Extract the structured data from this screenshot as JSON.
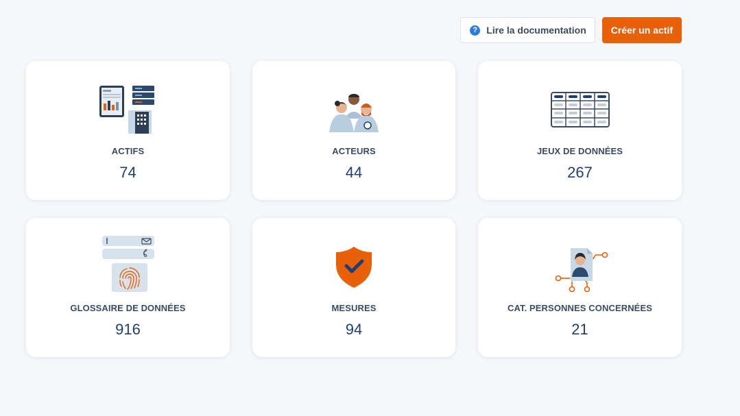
{
  "header": {
    "doc_button_label": "Lire la documentation",
    "create_button_label": "Créer un actif"
  },
  "cards": [
    {
      "label": "ACTIFS",
      "count": "74",
      "icon": "assets-icon"
    },
    {
      "label": "ACTEURS",
      "count": "44",
      "icon": "people-group-icon"
    },
    {
      "label": "JEUX DE DONNÉES",
      "count": "267",
      "icon": "data-table-icon"
    },
    {
      "label": "GLOSSAIRE DE DONNÉES",
      "count": "916",
      "icon": "fingerprint-form-icon"
    },
    {
      "label": "MESURES",
      "count": "94",
      "icon": "shield-check-icon"
    },
    {
      "label": "CAT. PERSONNES CONCERNÉES",
      "count": "21",
      "icon": "person-network-icon"
    }
  ],
  "colors": {
    "accent": "#e8600a",
    "count_text": "#1f3f73",
    "label_text": "#3a4a64",
    "help_icon": "#2a7de1"
  }
}
